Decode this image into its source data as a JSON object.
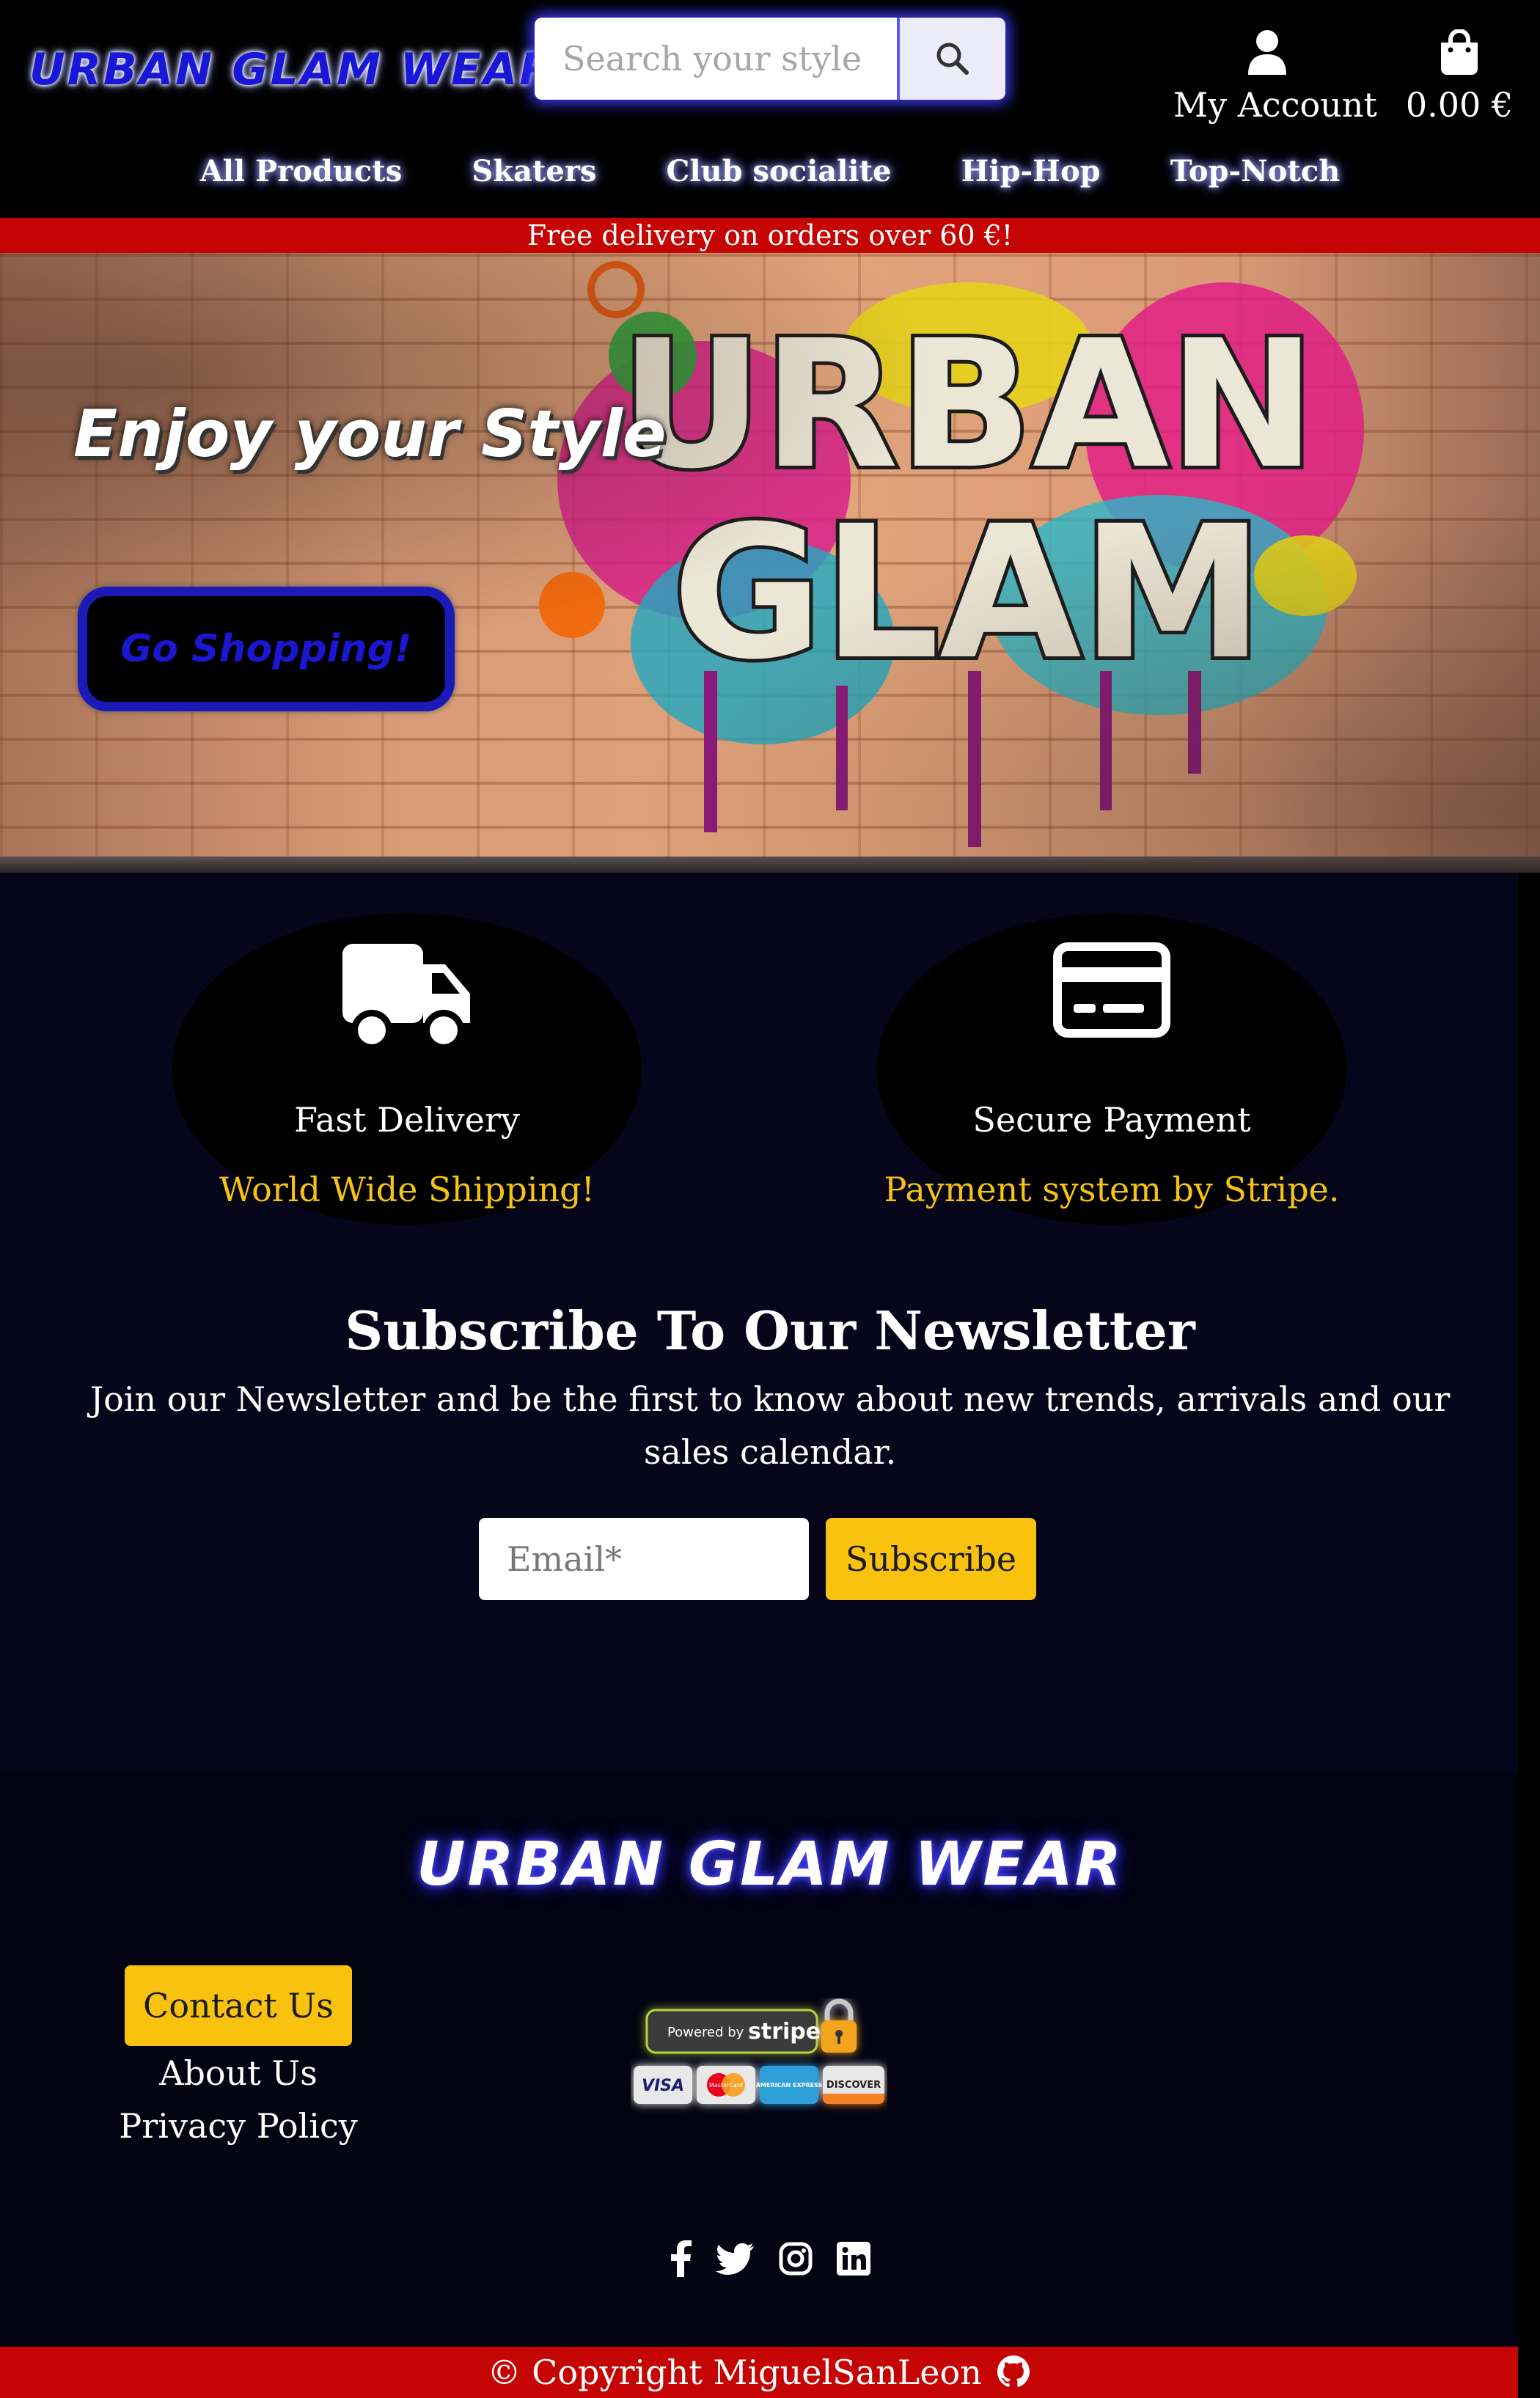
{
  "header": {
    "logo_text": "URBAN GLAM WEAR",
    "search_placeholder": "Search your style",
    "account_label": "My Account",
    "cart_total": "0.00 €"
  },
  "nav": {
    "items": [
      "All Products",
      "Skaters",
      "Club socialite",
      "Hip-Hop",
      "Top-Notch"
    ]
  },
  "promo": {
    "text": "Free delivery on orders over 60 €!"
  },
  "hero": {
    "heading": "Enjoy your Style",
    "cta_label": "Go Shopping!",
    "graffiti_line1": "URBAN",
    "graffiti_line2": "GLAM"
  },
  "features": [
    {
      "icon": "truck-icon",
      "title": "Fast Delivery",
      "subtitle": "World Wide Shipping!"
    },
    {
      "icon": "credit-card-icon",
      "title": "Secure Payment",
      "subtitle": "Payment system by Stripe."
    }
  ],
  "newsletter": {
    "title": "Subscribe To Our Newsletter",
    "text": "Join our Newsletter and be the first to know about new trends, arrivals and our sales calendar.",
    "email_placeholder": "Email*",
    "button_label": "Subscribe"
  },
  "footer": {
    "logo_text": "URBAN GLAM WEAR",
    "contact_label": "Contact Us",
    "about_label": "About Us",
    "privacy_label": "Privacy Policy",
    "stripe": {
      "powered_by": "Powered by",
      "brand": "stripe",
      "cards": [
        "VISA",
        "MasterCard",
        "AMERICAN EXPRESS",
        "DISCOVER"
      ]
    },
    "social_icons": [
      "facebook-icon",
      "twitter-icon",
      "instagram-icon",
      "linkedin-icon"
    ],
    "copyright": "© Copyright MiguelSanLeon"
  },
  "colors": {
    "accent_yellow": "#f9c20f",
    "promo_red": "#c50404",
    "brand_blue": "#1b1ab7",
    "page_background": "#06051a"
  }
}
